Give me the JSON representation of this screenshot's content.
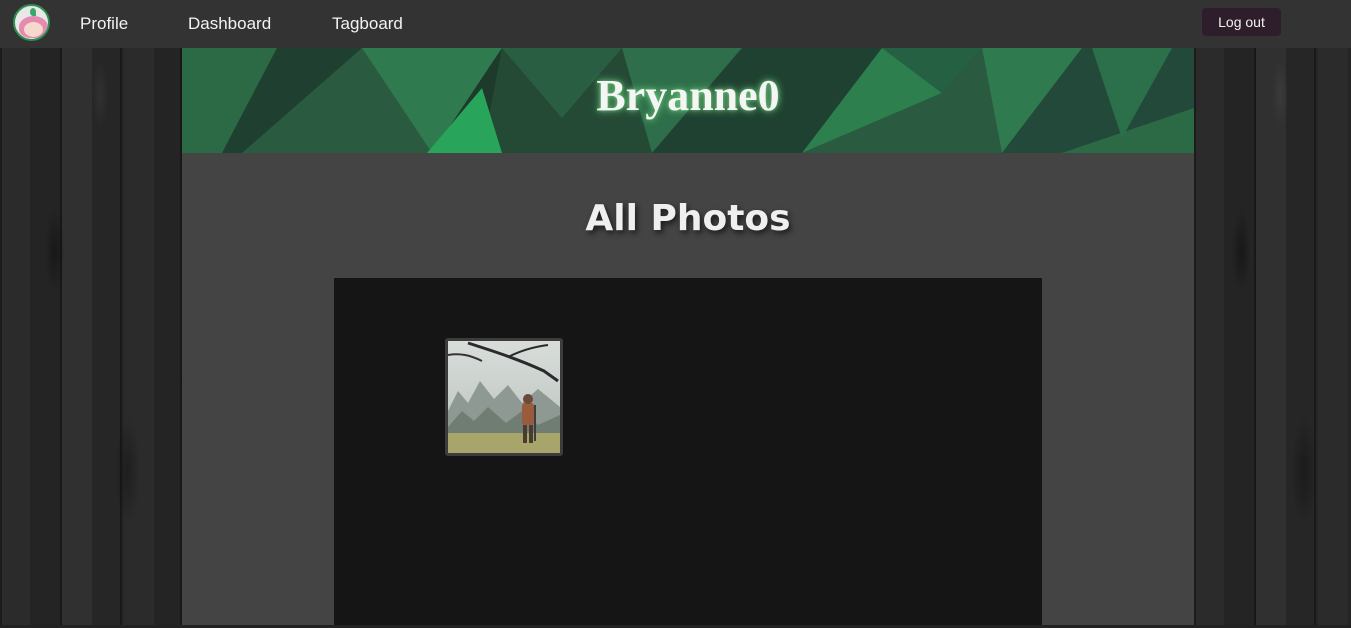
{
  "navbar": {
    "logo_icon": "avatar-logo-icon",
    "links": {
      "profile": "Profile",
      "dashboard": "Dashboard",
      "tagboard": "Tagboard"
    },
    "logout_label": "Log out"
  },
  "banner": {
    "username": "Bryanne0"
  },
  "main": {
    "section_title": "All Photos"
  },
  "gallery": {
    "photos": [
      {
        "subject": "misty-forest-wanderer-photo"
      }
    ]
  },
  "colors": {
    "navbar_bg": "#333333",
    "banner_green": "#2f7a4f",
    "panel_bg": "#444444",
    "gallery_bg": "#151515",
    "logout_bg": "#2e1e2b"
  }
}
